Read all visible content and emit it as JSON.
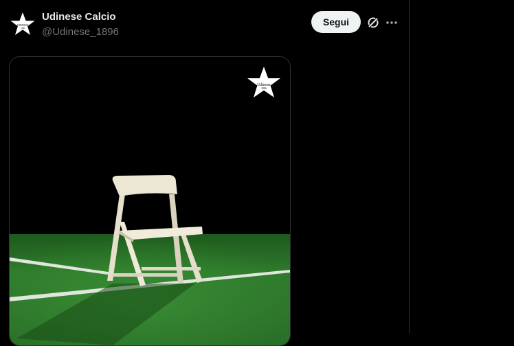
{
  "author": {
    "name": "Udinese Calcio",
    "handle": "@Udinese_1896",
    "avatar_icon": "udinese-star-logo",
    "logo_text": "UDINESE",
    "logo_year": "1896"
  },
  "actions": {
    "follow_label": "Segui",
    "grok_icon": "grok-icon",
    "more_icon": "more-options-icon"
  },
  "media": {
    "logo_icon": "udinese-star-logo",
    "logo_text": "Udinese",
    "logo_year": "1896"
  },
  "colors": {
    "background": "#000000",
    "follow_button_bg": "#eff3f4",
    "handle_gray": "#71767b",
    "pitch_green": "#2f7a2c"
  }
}
